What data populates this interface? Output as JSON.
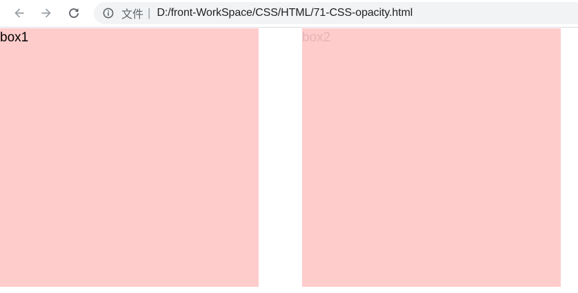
{
  "browser": {
    "address_bar": {
      "info_icon": "info-circle-icon",
      "scheme_label": "文件",
      "separator": "|",
      "url": "D:/front-WorkSpace/CSS/HTML/71-CSS-opacity.html"
    },
    "nav": {
      "back_icon": "arrow-left-icon",
      "forward_icon": "arrow-right-icon",
      "reload_icon": "reload-icon"
    }
  },
  "page": {
    "box1": {
      "label": "box1",
      "background": "#ffcccc",
      "text_color": "#000000"
    },
    "box2": {
      "label": "box2",
      "background": "#ffcccc",
      "text_color": "#e3b5b5"
    }
  }
}
